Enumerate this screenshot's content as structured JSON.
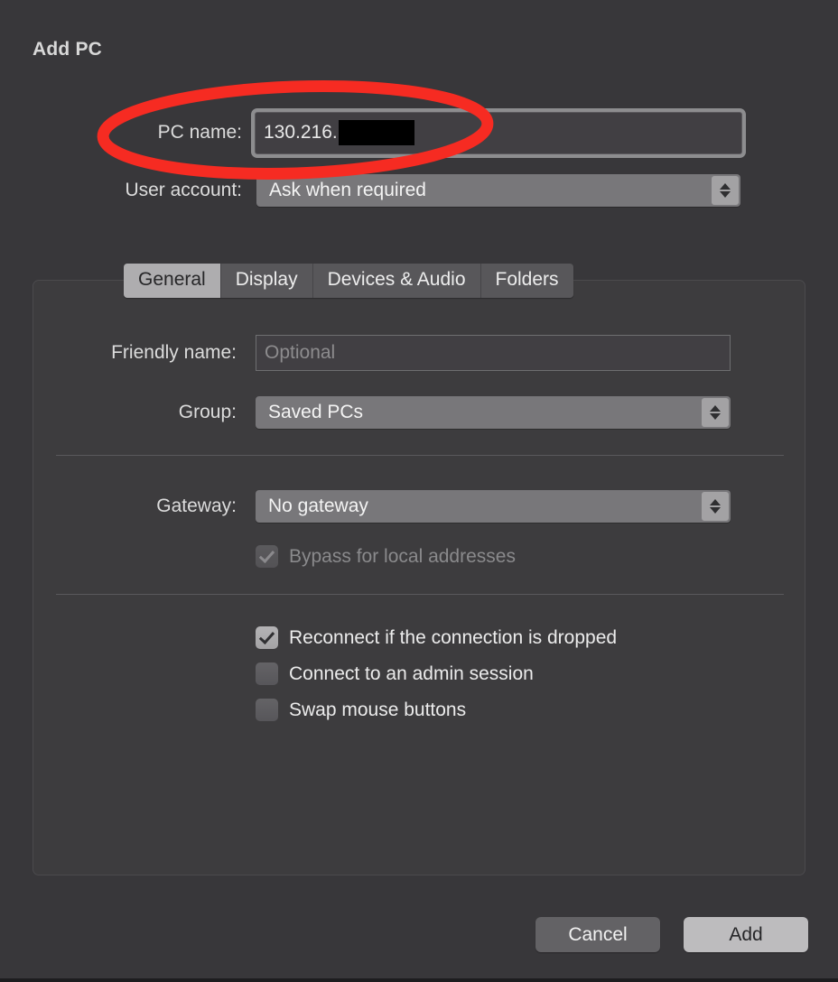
{
  "dialog": {
    "title": "Add PC"
  },
  "top_fields": {
    "pc_name": {
      "label": "PC name:",
      "value": "130.216.",
      "redacted": true
    },
    "user_account": {
      "label": "User account:",
      "value": "Ask when required"
    }
  },
  "tabs": [
    {
      "label": "General",
      "active": true
    },
    {
      "label": "Display",
      "active": false
    },
    {
      "label": "Devices & Audio",
      "active": false
    },
    {
      "label": "Folders",
      "active": false
    }
  ],
  "general_tab": {
    "friendly_name": {
      "label": "Friendly name:",
      "value": "",
      "placeholder": "Optional"
    },
    "group": {
      "label": "Group:",
      "value": "Saved PCs"
    },
    "gateway": {
      "label": "Gateway:",
      "value": "No gateway"
    },
    "bypass_local": {
      "label": "Bypass for local addresses",
      "checked": true,
      "disabled": true
    },
    "options": [
      {
        "label": "Reconnect if the connection is dropped",
        "checked": true
      },
      {
        "label": "Connect to an admin session",
        "checked": false
      },
      {
        "label": "Swap mouse buttons",
        "checked": false
      }
    ]
  },
  "footer": {
    "cancel_label": "Cancel",
    "add_label": "Add"
  },
  "annotation": {
    "type": "ellipse-highlight",
    "color": "#f62b22",
    "target": "pc-name-field"
  }
}
